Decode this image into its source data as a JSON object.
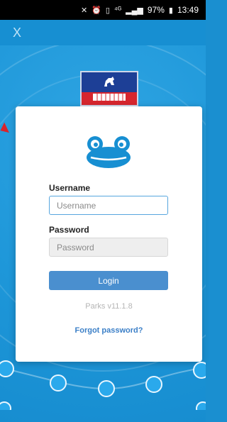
{
  "status_bar": {
    "signal_text": "⁴ᴳ",
    "battery": "97%",
    "time": "13:49"
  },
  "app_bar": {
    "close_label": "X"
  },
  "login": {
    "username_label": "Username",
    "username_placeholder": "Username",
    "password_label": "Password",
    "password_placeholder": "Password",
    "login_button": "Login",
    "version": "Parks v11.1.8",
    "forgot_password": "Forgot password?"
  },
  "colors": {
    "primary": "#178fd2",
    "button": "#4a8fcf",
    "link": "#3b7fc7",
    "crest_blue": "#1d3f96",
    "crest_red": "#d7262e"
  },
  "icons": [
    "close-icon",
    "frog-logo",
    "school-crest-icon"
  ]
}
